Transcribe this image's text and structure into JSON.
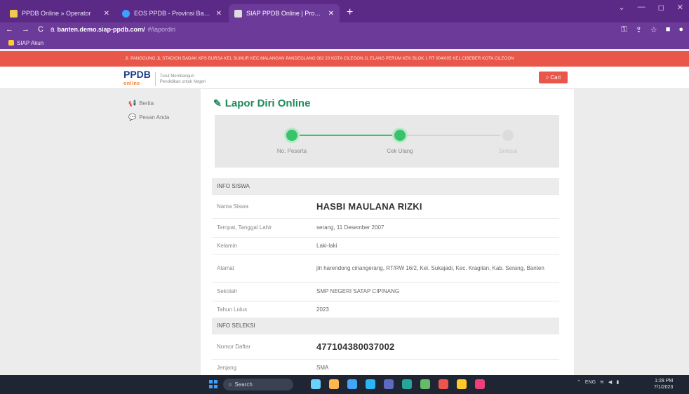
{
  "browser": {
    "tabs": [
      {
        "title": "PPDB Online » Operator",
        "color": "#f2c94c",
        "active": false
      },
      {
        "title": "EOS PPDB - Provinsi Banten",
        "color": "#3ca0ff",
        "active": false
      },
      {
        "title": "SIAP PPDB Online | Provinsi Ban",
        "color": "#dddddd",
        "active": true
      }
    ],
    "new_tab": "+",
    "back": "←",
    "forward": "→",
    "reload": "C",
    "lock": "a",
    "url_host": "banten.demo.siap-ppdb.com/",
    "url_path": "#/lapordiri",
    "bookmark": "SIAP Akun"
  },
  "site": {
    "banner": "Jl. PANGGUNG JL STADION BADAK KPS BURSA KEL SUMUR KEC.MALANGAN PANDEGLANG 082 20 KOTA CILEGON JL ELANG PERUM KEK BLOK 1 RT 004/005 KEL CIBEBER KOTA CILEGON",
    "logo": {
      "main": "PPDB",
      "sub": "online",
      "tagline_1": "Turut Membangun",
      "tagline_2": "Pendidikan untuk Negeri"
    },
    "search_button": "Cari"
  },
  "sidebar": {
    "items": [
      {
        "label": "Berita",
        "icon": "megaphone-icon"
      },
      {
        "label": "Pesan Anda",
        "icon": "chat-icon"
      }
    ]
  },
  "main": {
    "title": "Lapor Diri Online",
    "steps": [
      {
        "label": "No. Peserta",
        "done": true
      },
      {
        "label": "Cek Ulang",
        "done": true
      },
      {
        "label": "Selesai",
        "done": false
      }
    ],
    "sections": {
      "info_siswa": "INFO SISWA",
      "info_seleksi": "INFO SELEKSI"
    },
    "fields": {
      "nama": {
        "label": "Nama Siswa",
        "value": "HASBI MAULANA RIZKI"
      },
      "ttl": {
        "label": "Tempat, Tanggal Lahir",
        "value": "serang, 11 Desember 2007"
      },
      "kelamin": {
        "label": "Kelamin",
        "value": "Laki-laki"
      },
      "alamat": {
        "label": "Alamat",
        "value": "jln harendong cinangerang, RT/RW 16/2, Kel. Sukajadi, Kec. Kragilan, Kab. Serang, Banten"
      },
      "sekolah": {
        "label": "Sekolah",
        "value": "SMP NEGERI SATAP CIPINANG"
      },
      "tahun": {
        "label": "Tahun Lulus",
        "value": "2023"
      },
      "nomor": {
        "label": "Nomor Daftar",
        "value": "477104380037002"
      },
      "jenjang": {
        "label": "Jenjang",
        "value": "SMA"
      }
    }
  },
  "taskbar": {
    "search": "Search",
    "lang": "ENG",
    "time": "1:28 PM",
    "date": "7/1/2023"
  }
}
